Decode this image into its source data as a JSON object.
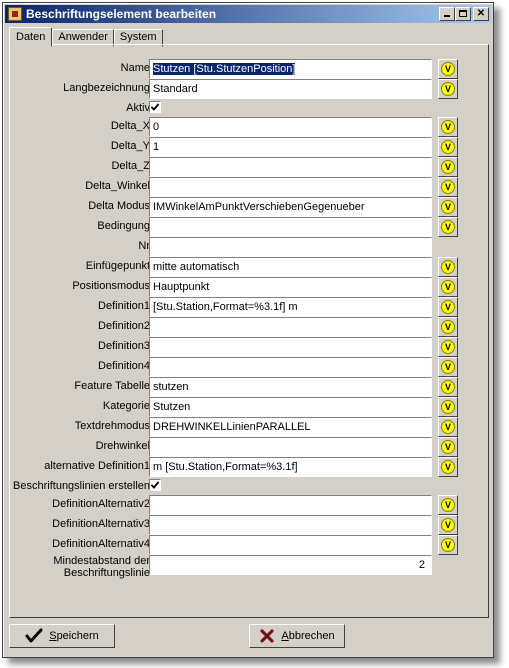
{
  "window": {
    "title": "Beschriftungselement bearbeiten"
  },
  "tabs": [
    "Daten",
    "Anwender",
    "System"
  ],
  "v_label": "V",
  "fields": [
    {
      "label": "Name",
      "value": "Stutzen [Stu.StutzenPosition]",
      "type": "text",
      "vbtn": true,
      "selected": true
    },
    {
      "label": "Langbezeichnung",
      "value": "Standard",
      "type": "text",
      "vbtn": true
    },
    {
      "label": "Aktiv",
      "type": "checkbox",
      "checked": true
    },
    {
      "label": "Delta_X",
      "value": "0",
      "type": "text",
      "vbtn": true
    },
    {
      "label": "Delta_Y",
      "value": "1",
      "type": "text",
      "vbtn": true
    },
    {
      "label": "Delta_Z",
      "value": "",
      "type": "text",
      "vbtn": true
    },
    {
      "label": "Delta_Winkel",
      "value": "",
      "type": "text",
      "vbtn": true
    },
    {
      "label": "Delta Modus",
      "value": "IMWinkelAmPunktVerschiebenGegenueber",
      "type": "text",
      "vbtn": true
    },
    {
      "label": "Bedingung",
      "value": "",
      "type": "text",
      "vbtn": true
    },
    {
      "label": "Nr",
      "value": "",
      "type": "text",
      "vbtn": false
    },
    {
      "label": "Einfügepunkt",
      "value": "mitte automatisch",
      "type": "text",
      "vbtn": true
    },
    {
      "label": "Positionsmodus",
      "value": "Hauptpunkt",
      "type": "text",
      "vbtn": true
    },
    {
      "label": "Definition1",
      "value": "[Stu.Station,Format=%3.1f] m",
      "type": "text",
      "vbtn": true
    },
    {
      "label": "Definition2",
      "value": "",
      "type": "text",
      "vbtn": true
    },
    {
      "label": "Definition3",
      "value": "",
      "type": "text",
      "vbtn": true
    },
    {
      "label": "Definition4",
      "value": "",
      "type": "text",
      "vbtn": true
    },
    {
      "label": "Feature Tabelle",
      "value": "stutzen",
      "type": "text",
      "vbtn": true
    },
    {
      "label": "Kategorie",
      "value": "Stutzen",
      "type": "text",
      "vbtn": true
    },
    {
      "label": "Textdrehmodus",
      "value": "DREHWINKELLinienPARALLEL",
      "type": "text",
      "vbtn": true
    },
    {
      "label": "Drehwinkel",
      "value": "",
      "type": "text",
      "vbtn": true
    },
    {
      "label": "alternative Definition1",
      "value": "m [Stu.Station,Format=%3.1f]",
      "type": "text",
      "vbtn": true
    },
    {
      "label": "Beschriftungslinien erstellen",
      "type": "checkbox",
      "checked": true
    },
    {
      "label": "DefinitionAlternativ2",
      "value": "",
      "type": "text",
      "vbtn": true
    },
    {
      "label": "DefinitionAlternativ3",
      "value": "",
      "type": "text",
      "vbtn": true
    },
    {
      "label": "DefinitionAlternativ4",
      "value": "",
      "type": "text",
      "vbtn": true
    },
    {
      "label": "Mindestabstand der Beschriftungslinie",
      "label_lines": [
        "Mindestabstand der",
        "Beschriftungslinie"
      ],
      "value": "2",
      "type": "number",
      "vbtn": false
    }
  ],
  "buttons": {
    "save": {
      "accel": "S",
      "rest": "peichern"
    },
    "cancel": {
      "accel": "A",
      "rest": "bbrechen"
    }
  }
}
